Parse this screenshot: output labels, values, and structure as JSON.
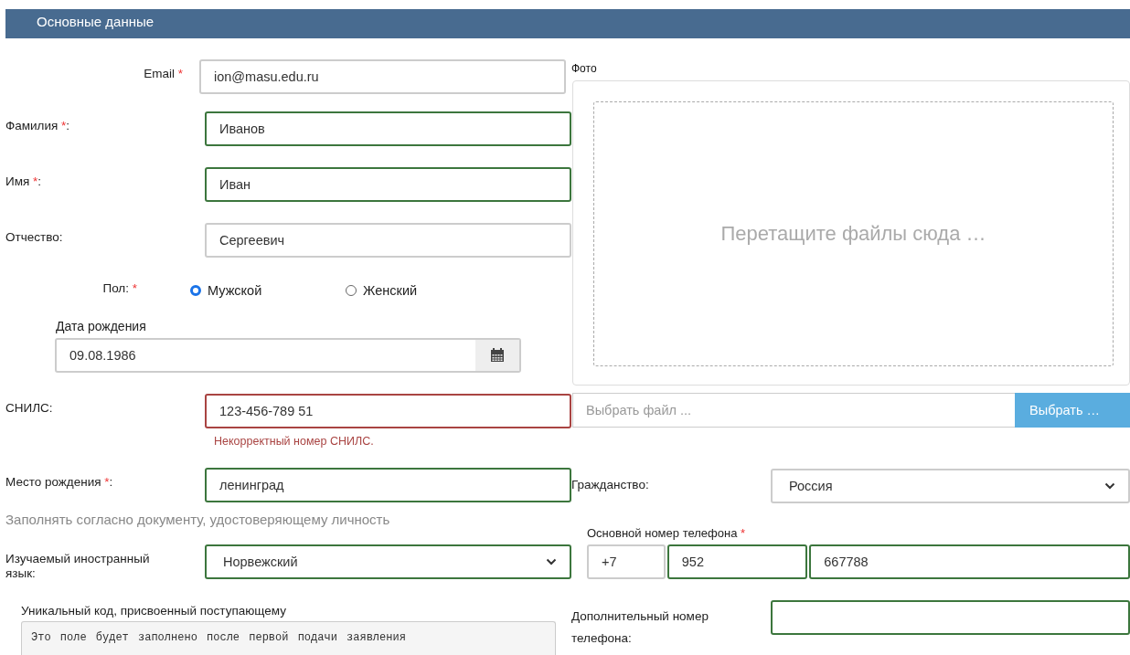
{
  "section": {
    "title": "Основные данные"
  },
  "left_fields": [
    {
      "kind": "input",
      "label": "Email",
      "mark": "*",
      "right_aligned": true,
      "value": "ion@masu.edu.ru",
      "valid": false,
      "invalid": false
    },
    {
      "kind": "input",
      "label": "Фамилия",
      "mark": "*",
      "suffix": ":",
      "right_aligned": false,
      "value": "Иванов",
      "valid": true,
      "invalid": false
    },
    {
      "kind": "input",
      "label": "Имя",
      "mark": "*",
      "suffix": ":",
      "right_aligned": false,
      "value": "Иван",
      "valid": true,
      "invalid": false
    },
    {
      "kind": "input",
      "label": "Отчество",
      "suffix": ":",
      "right_aligned": false,
      "value": "Сергеевич",
      "valid": false,
      "invalid": false
    },
    {
      "kind": "radio",
      "label": "Пол:",
      "mark": "*",
      "options": [
        {
          "label": "Мужской",
          "selected": true
        },
        {
          "label": "Женский",
          "selected": false
        }
      ]
    },
    {
      "kind": "date",
      "label": "Дата рождения",
      "value": "09.08.1986"
    },
    {
      "kind": "input",
      "label": "СНИЛС",
      "suffix": ":",
      "right_aligned": false,
      "value": "123-456-789 51",
      "valid": false,
      "invalid": true,
      "error": "Некорректный номер СНИЛС."
    },
    {
      "kind": "input",
      "label": "Место рождения",
      "mark": "*",
      "suffix": ":",
      "right_aligned": false,
      "value": "ленинград",
      "valid": true,
      "invalid": false
    },
    {
      "kind": "hint",
      "text": "Заполнять согласно документу, удостоверяющему личность"
    },
    {
      "kind": "select",
      "label": "Изучаемый иностранный язык",
      "suffix": ":",
      "right_aligned": false,
      "value": "Норвежский",
      "valid": true,
      "invalid": false
    },
    {
      "kind": "readonly",
      "label": "Уникальный код, присвоенный поступающему",
      "value": "Это поле будет заполнено после первой подачи заявления"
    }
  ],
  "photo": {
    "label": "Фото",
    "dropzone_text": "Перетащите файлы сюда …",
    "file_placeholder": "Выбрать файл ...",
    "browse_button": "Выбрать …"
  },
  "right_fields": [
    {
      "kind": "select",
      "label": "Гражданство",
      "suffix": ":",
      "value": "Россия",
      "valid": false,
      "invalid": false
    },
    {
      "kind": "phone",
      "label": "Основной номер телефона",
      "mark": "*",
      "parts": [
        {
          "value": "+7",
          "valid": false,
          "invalid": false
        },
        {
          "value": "952",
          "valid": true,
          "invalid": false
        },
        {
          "value": "667788",
          "valid": true,
          "invalid": false
        }
      ]
    },
    {
      "kind": "input",
      "label": "Дополнительный номер телефона",
      "suffix": ":",
      "valid": true,
      "invalid": false
    }
  ]
}
